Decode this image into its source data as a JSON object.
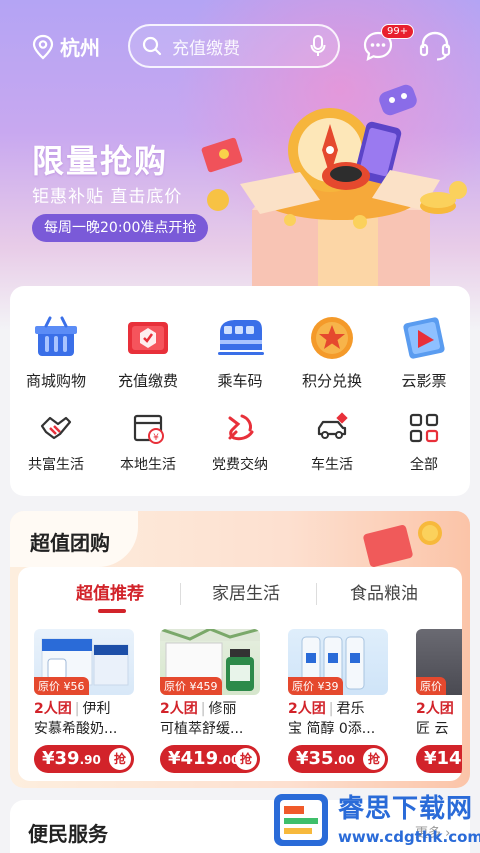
{
  "header": {
    "city": "杭州",
    "search_placeholder": "充值缴费",
    "message_badge": "99+"
  },
  "promo": {
    "title": "限量抢购",
    "subtitle": "钜惠补贴 直击底价",
    "schedule": "每周一晚20:00准点开抢"
  },
  "services": {
    "row1": [
      {
        "label": "商城购物",
        "icon": "shopping-basket-icon"
      },
      {
        "label": "充值缴费",
        "icon": "recharge-card-icon"
      },
      {
        "label": "乘车码",
        "icon": "train-icon"
      },
      {
        "label": "积分兑换",
        "icon": "star-medal-icon"
      },
      {
        "label": "云影票",
        "icon": "movie-ticket-icon"
      }
    ],
    "row2": [
      {
        "label": "共富生活",
        "icon": "handshake-icon"
      },
      {
        "label": "本地生活",
        "icon": "local-shop-icon"
      },
      {
        "label": "党费交纳",
        "icon": "party-emblem-icon"
      },
      {
        "label": "车生活",
        "icon": "car-icon"
      },
      {
        "label": "全部",
        "icon": "grid-all-icon"
      }
    ]
  },
  "group_buy": {
    "title": "超值团购",
    "tabs": [
      "超值推荐",
      "家居生活",
      "食品粮油"
    ],
    "products": [
      {
        "orig": "原价 ¥56",
        "tag": "2人团",
        "title1": "伊利",
        "title2": "安慕希酸奶...",
        "price": "¥39",
        "cents": ".90",
        "grab": "抢"
      },
      {
        "orig": "原价 ¥459",
        "tag": "2人团",
        "title1": "修丽",
        "title2": "可植萃舒缓...",
        "price": "¥419",
        "cents": ".00",
        "grab": "抢"
      },
      {
        "orig": "原价 ¥39",
        "tag": "2人团",
        "title1": "君乐",
        "title2": "宝 简醇 0添...",
        "price": "¥35",
        "cents": ".00",
        "grab": "抢"
      },
      {
        "orig": "原价",
        "tag": "2人团",
        "title1": "",
        "title2": "匠 云",
        "price": "¥14",
        "cents": "",
        "grab": ""
      }
    ]
  },
  "bottom": {
    "title": "便民服务",
    "more": "更多 ›"
  },
  "watermark": {
    "line1": "睿思下载网",
    "line2": "www.cdgthk.com"
  },
  "colors": {
    "brand_red": "#d2232a",
    "hero_purple": "#b4a4f4"
  }
}
